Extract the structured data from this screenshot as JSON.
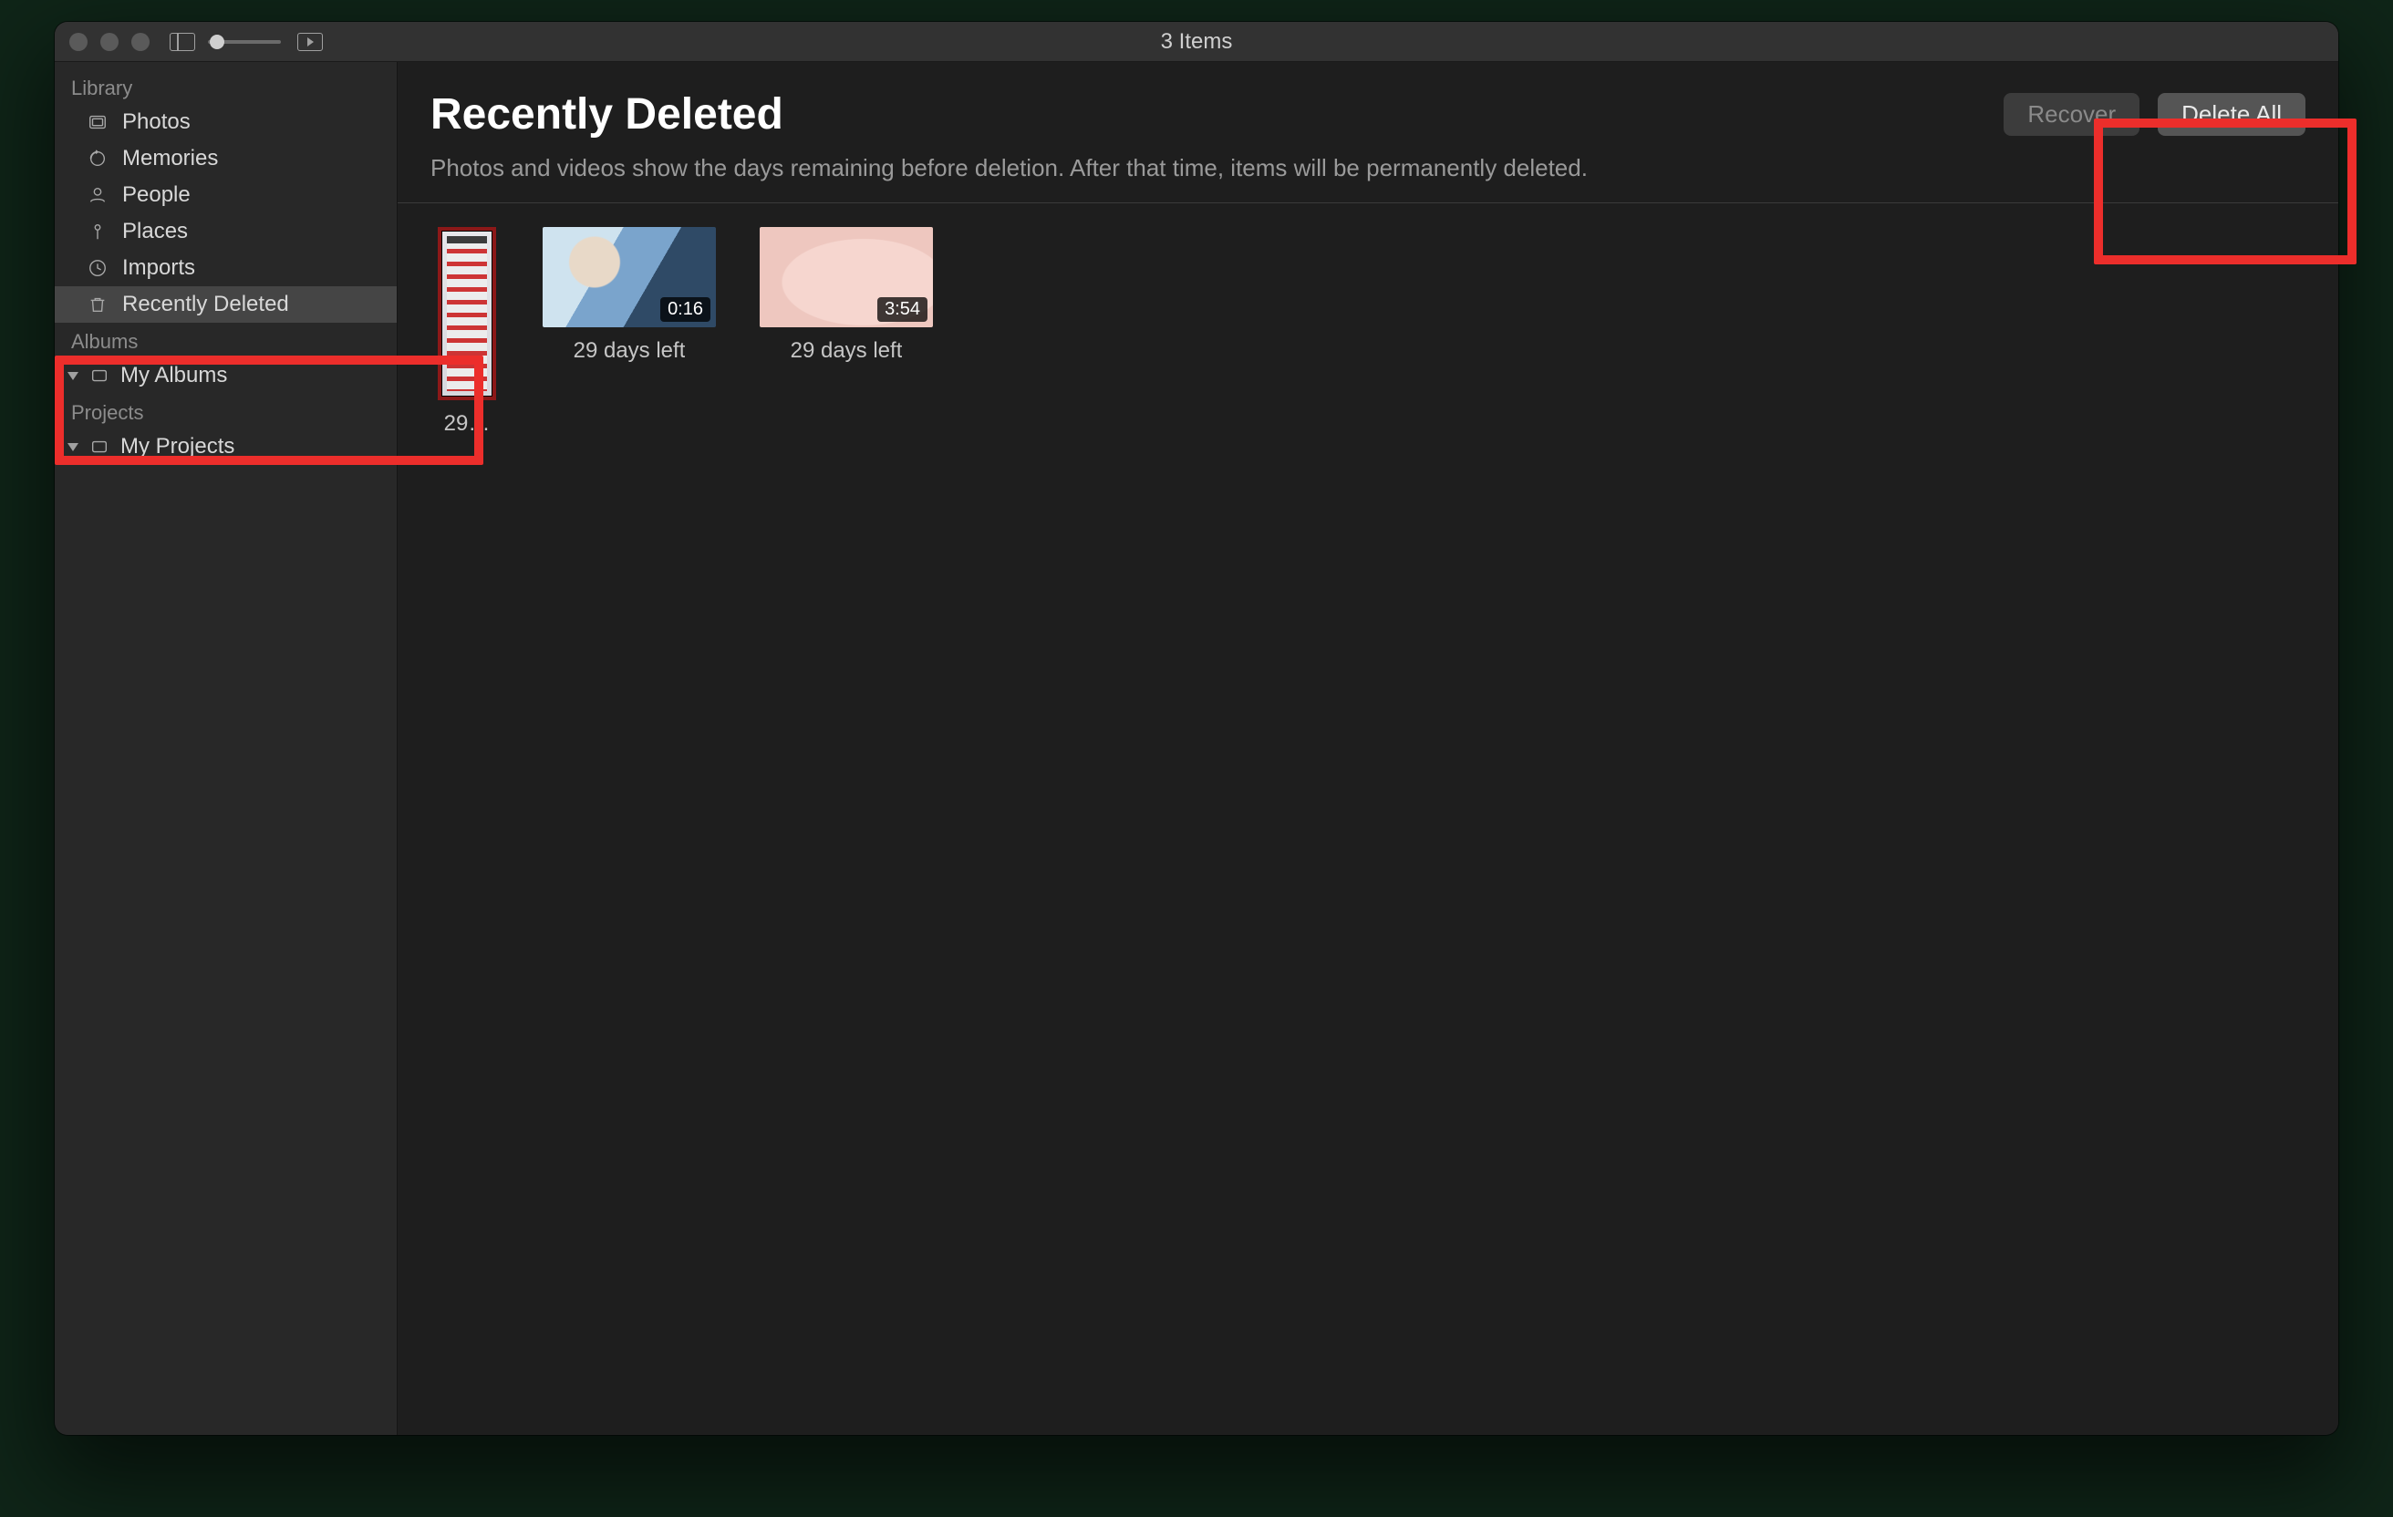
{
  "titlebar": {
    "title": "3 Items"
  },
  "sidebar": {
    "sections": {
      "library": {
        "header": "Library",
        "items": [
          {
            "label": "Photos",
            "icon": "photos"
          },
          {
            "label": "Memories",
            "icon": "memories"
          },
          {
            "label": "People",
            "icon": "people"
          },
          {
            "label": "Places",
            "icon": "places"
          },
          {
            "label": "Imports",
            "icon": "imports"
          },
          {
            "label": "Recently Deleted",
            "icon": "trash",
            "selected": true
          }
        ]
      },
      "albums": {
        "header": "Albums",
        "items": [
          {
            "label": "My Albums",
            "icon": "album",
            "disclosure": true
          }
        ]
      },
      "projects": {
        "header": "Projects",
        "items": [
          {
            "label": "My Projects",
            "icon": "album",
            "disclosure": true
          }
        ]
      }
    }
  },
  "main": {
    "title": "Recently Deleted",
    "subtitle": "Photos and videos show the days remaining before deletion. After that time, items will be permanently deleted.",
    "actions": {
      "recover": "Recover",
      "delete_all": "Delete All"
    },
    "items": [
      {
        "kind": "photo",
        "label": "29…",
        "style": "portrait"
      },
      {
        "kind": "video",
        "label": "29 days left",
        "duration": "0:16",
        "style": "vid1"
      },
      {
        "kind": "video",
        "label": "29 days left",
        "duration": "3:54",
        "style": "vid2"
      }
    ]
  },
  "annotations": [
    {
      "name": "sidebar-recently-deleted-highlight"
    },
    {
      "name": "delete-all-highlight"
    }
  ]
}
